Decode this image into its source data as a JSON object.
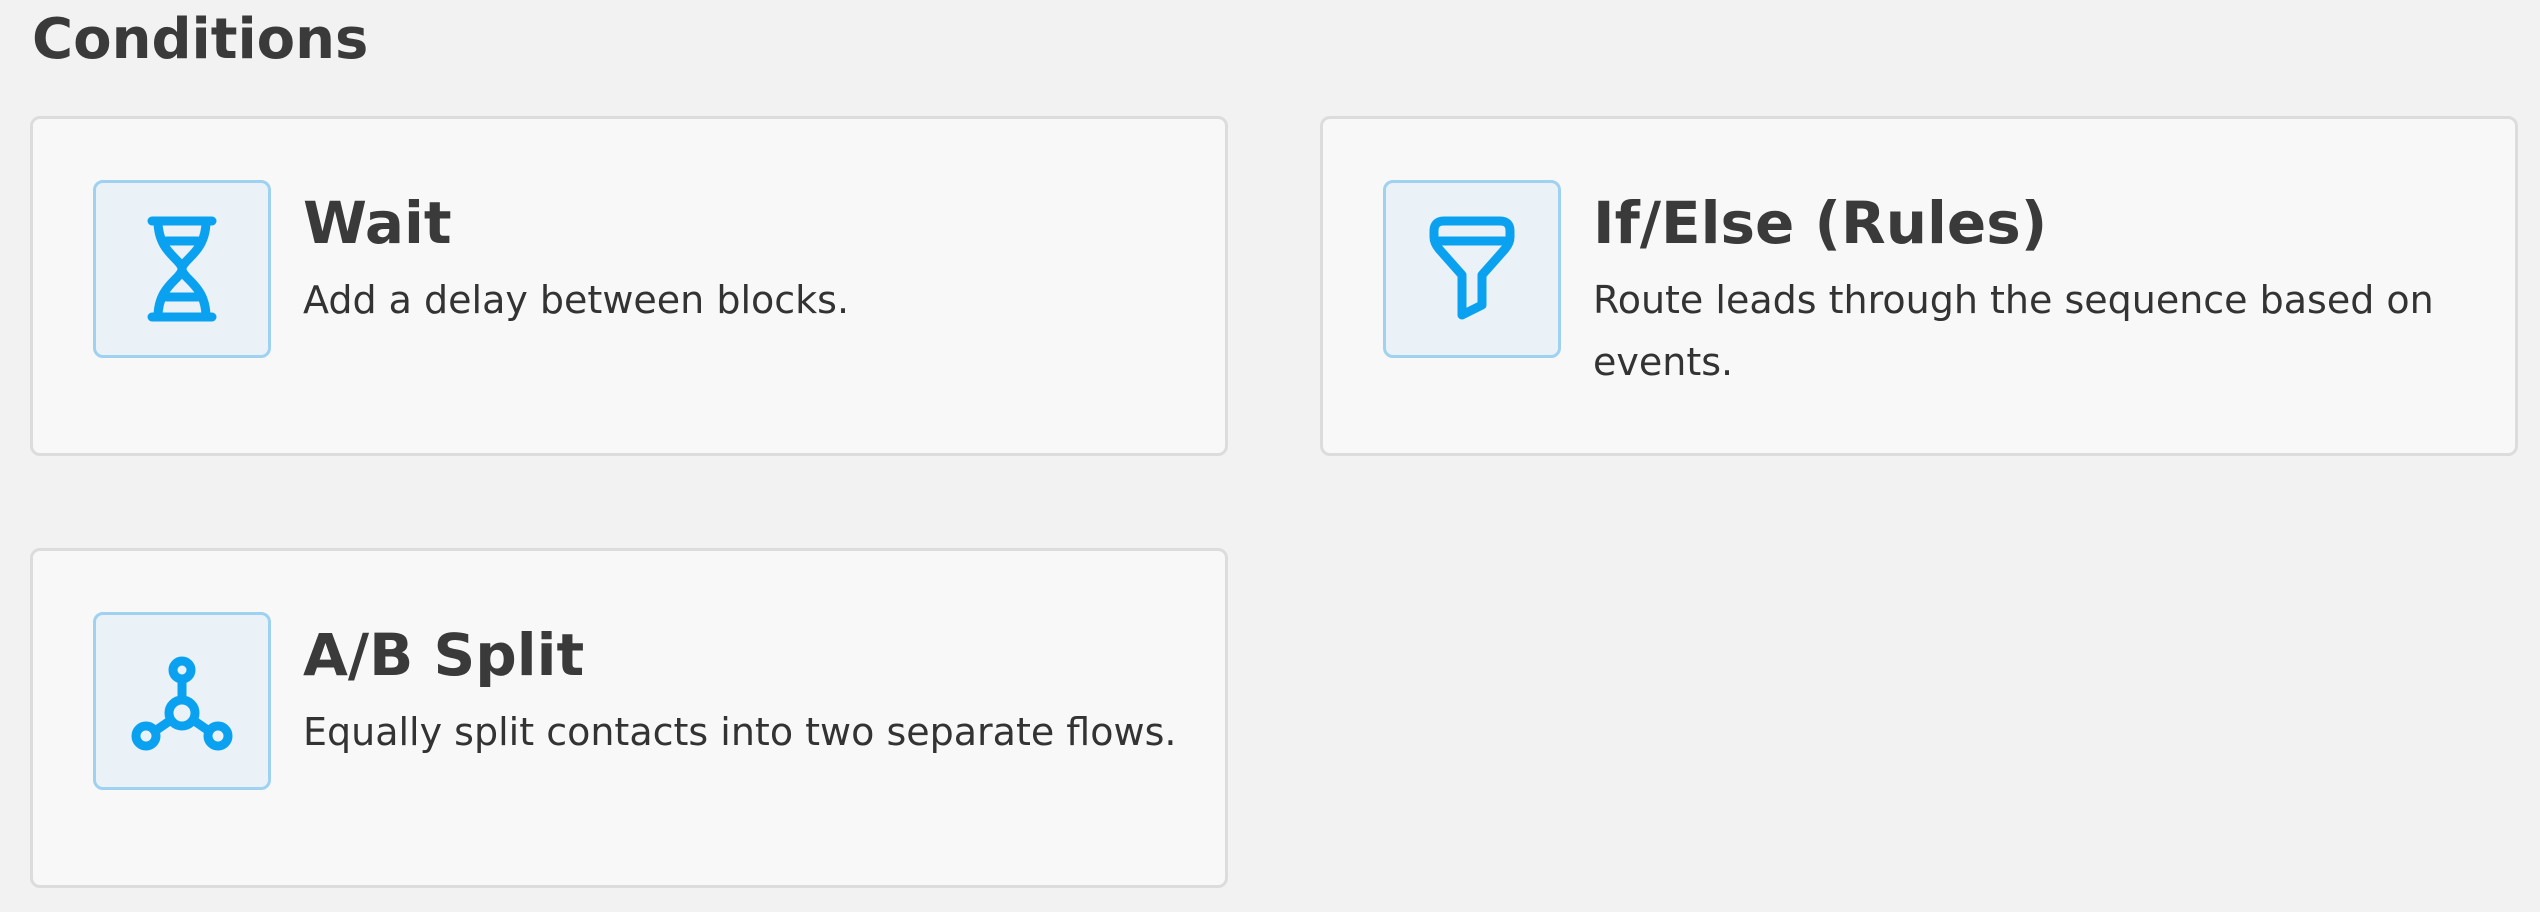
{
  "section": {
    "title": "Conditions"
  },
  "colors": {
    "accent": "#0aa2f0",
    "icon_bg": "#eaf1f7",
    "icon_border": "#9fd1f0",
    "card_bg": "#f8f8f8",
    "card_border": "#dcdcdc",
    "page_bg": "#f2f2f2"
  },
  "cards": [
    {
      "icon": "hourglass-icon",
      "title": "Wait",
      "description": "Add a delay between blocks."
    },
    {
      "icon": "filter-funnel-icon",
      "title": "If/Else (Rules)",
      "description": "Route leads through the sequence based on events."
    },
    {
      "icon": "split-branch-icon",
      "title": "A/B Split",
      "description": "Equally split contacts into two separate flows."
    }
  ]
}
